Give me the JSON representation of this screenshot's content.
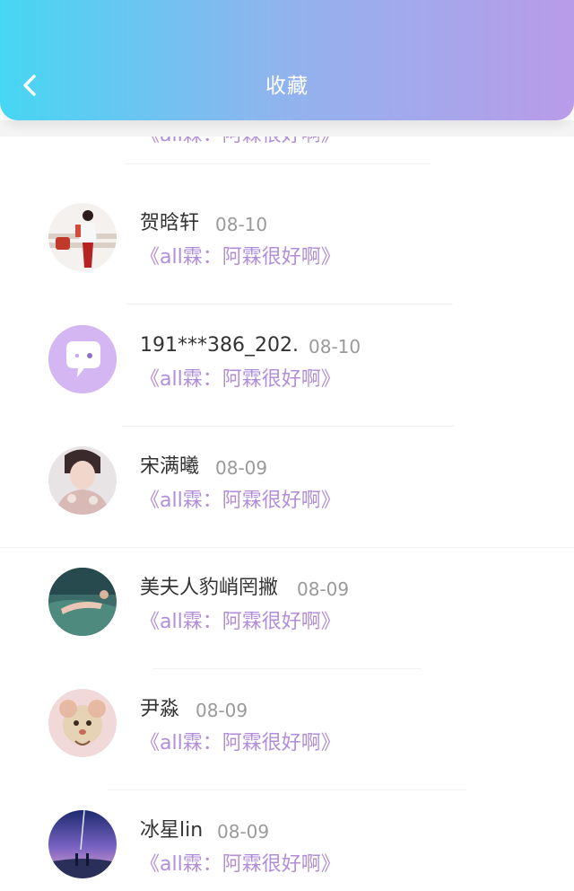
{
  "header": {
    "title": "收藏",
    "back_icon": "chevron-left-icon"
  },
  "colors": {
    "accent_purple": "#b28ed8",
    "gradient_start": "#46d6f3",
    "gradient_end": "#b99be9"
  },
  "favorites": [
    {
      "name": "",
      "date": "",
      "work": "《all霖：阿霖很好啊》",
      "partial": true
    },
    {
      "name": "贺晗轩",
      "date": "08-10",
      "work": "《all霖：阿霖很好啊》"
    },
    {
      "name": "191***386_202.",
      "date": "08-10",
      "work": "《all霖：阿霖很好啊》",
      "avatar": "default-chat-bubble-avatar"
    },
    {
      "name": "宋满曦",
      "date": "08-09",
      "work": "《all霖：阿霖很好啊》"
    },
    {
      "name": "美夫人豹峭罔撇",
      "date": "08-09",
      "work": "《all霖：阿霖很好啊》"
    },
    {
      "name": "尹淼",
      "date": "08-09",
      "work": "《all霖：阿霖很好啊》"
    },
    {
      "name": "冰星lin",
      "date": "08-09",
      "work": "《all霖：阿霖很好啊》"
    }
  ]
}
